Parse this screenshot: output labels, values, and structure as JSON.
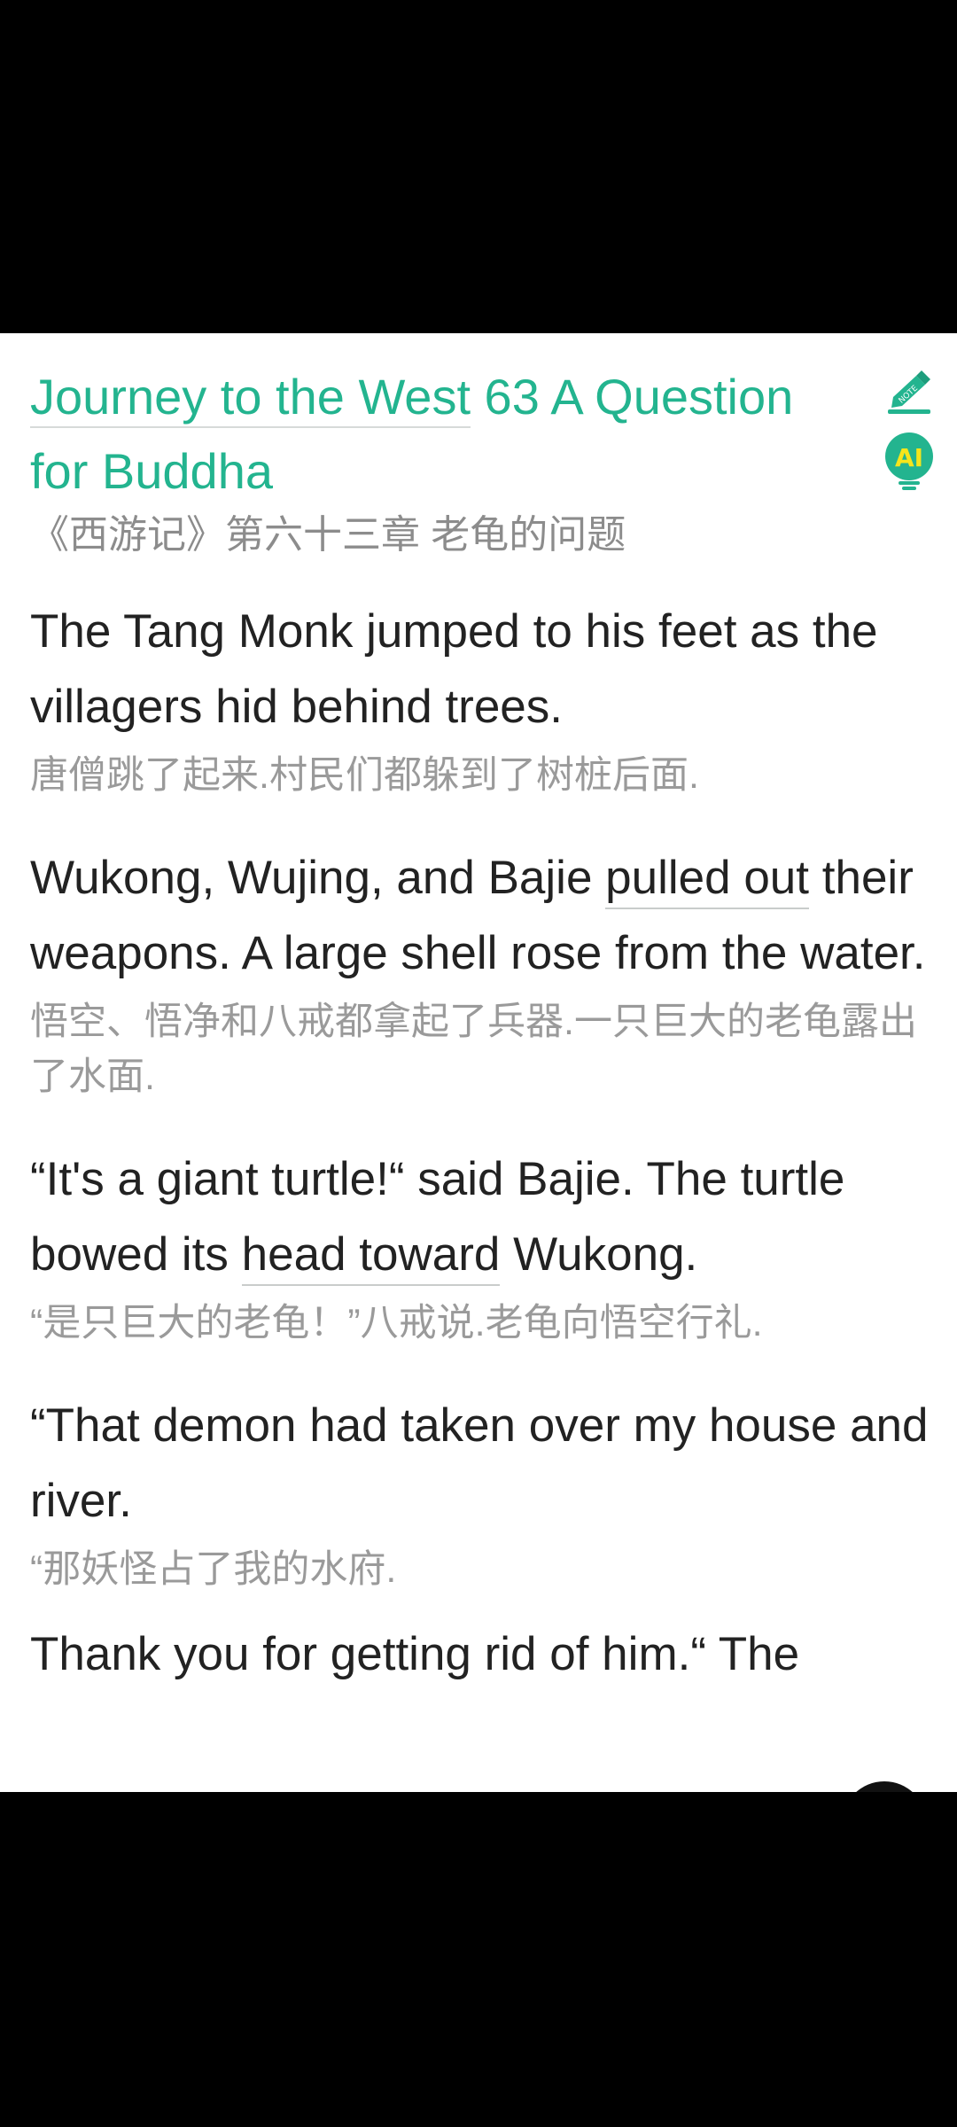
{
  "article": {
    "title_part1": "Journey to the West",
    "title_part2": " 63 A Question for Buddha",
    "subtitle": "《西游记》第六十三章 老龟的问题"
  },
  "tools": {
    "note_label": "NOTE",
    "ai_label": "AI",
    "accent": "#23b48f",
    "ai_color": "#f5e51b"
  },
  "paragraphs": [
    {
      "en_pre": "The Tang Monk jumped to his feet as the villagers hid behind trees.",
      "en_ul": "",
      "en_post": "",
      "zh": "唐僧跳了起来.村民们都躲到了树桩后面."
    },
    {
      "en_pre": "Wukong, Wujing, and Bajie ",
      "en_ul": "pulled out",
      "en_post": " their weapons. A large shell rose from the water.",
      "zh": "悟空、悟净和八戒都拿起了兵器.一只巨大的老龟露出了水面."
    },
    {
      "en_pre": "“It's a giant turtle!“ said Bajie. The turtle bowed its ",
      "en_ul": "head toward",
      "en_post": " Wukong.",
      "zh": "“是只巨大的老龟！”八戒说.老龟向悟空行礼."
    },
    {
      "en_pre": "“That demon had taken over my house and river.",
      "en_ul": "",
      "en_post": "",
      "zh": "“那妖怪占了我的水府."
    }
  ],
  "partial_line": "Thank you for getting rid of him.“ The"
}
